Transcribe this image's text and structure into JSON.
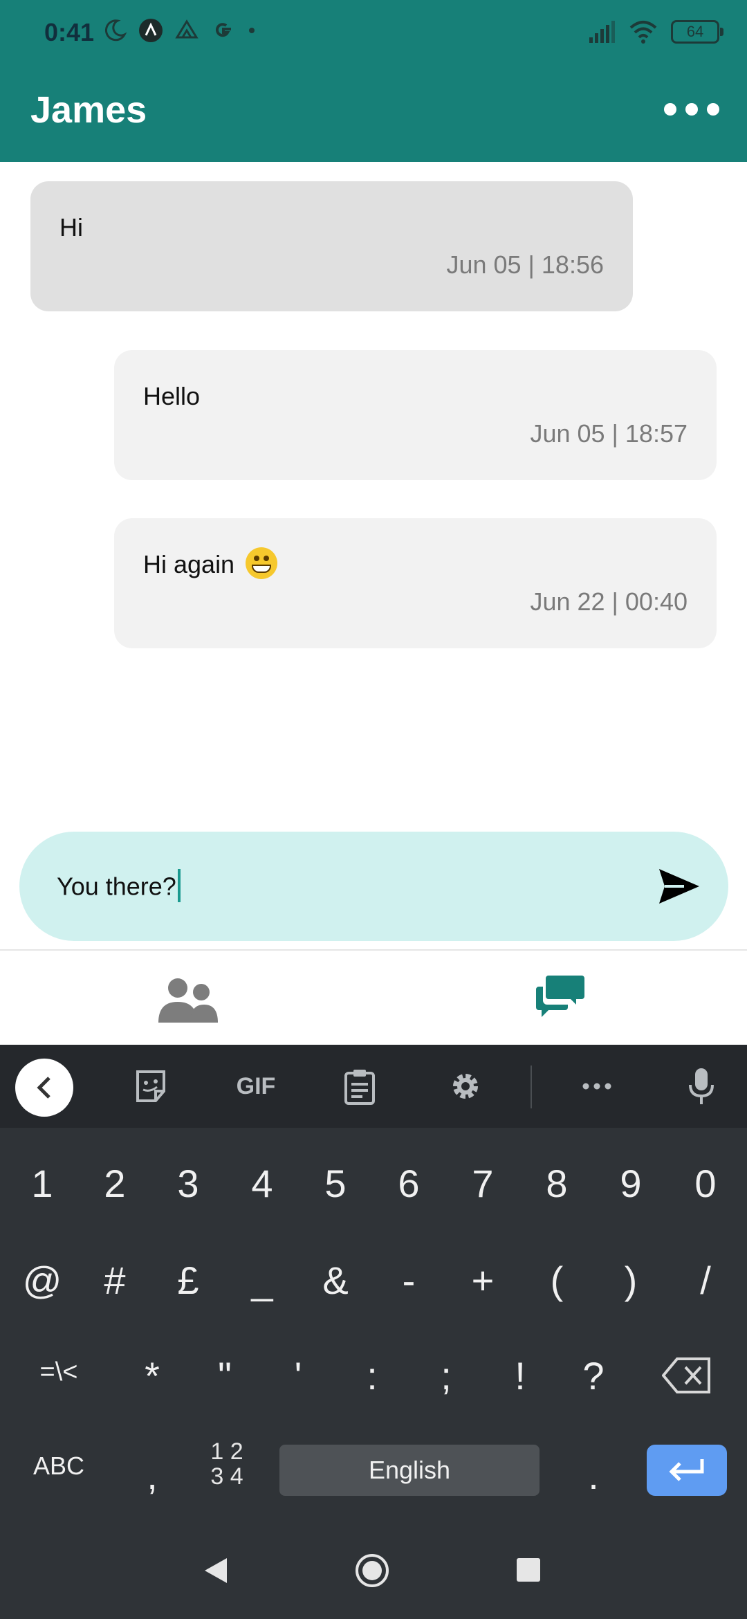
{
  "status_bar": {
    "time": "0:41",
    "battery": "64"
  },
  "header": {
    "title": "James"
  },
  "messages": [
    {
      "text": "Hi",
      "time": "Jun 05 | 18:56",
      "direction": "incoming"
    },
    {
      "text": "Hello",
      "time": "Jun 05 | 18:57",
      "direction": "outgoing"
    },
    {
      "text": "Hi again",
      "time": "Jun 22 | 00:40",
      "direction": "outgoing",
      "emoji": "grinning-face"
    }
  ],
  "composer": {
    "value": "You there?"
  },
  "keyboard": {
    "toolbar": {
      "gif_label": "GIF"
    },
    "row1": [
      "1",
      "2",
      "3",
      "4",
      "5",
      "6",
      "7",
      "8",
      "9",
      "0"
    ],
    "row2": [
      "@",
      "#",
      "£",
      "_",
      "&",
      "-",
      "+",
      "(",
      ")",
      "/"
    ],
    "row3": [
      "=\\<",
      "*",
      "\"",
      "'",
      ":",
      ";",
      "!",
      "?"
    ],
    "abc_label": "ABC",
    "comma": ",",
    "numpad_label_top": "1 2",
    "numpad_label_bottom": "3 4",
    "space_label": "English",
    "period": "."
  },
  "colors": {
    "header": "#178078",
    "accent": "#1a9a8f",
    "input_bg": "#d0f1ef",
    "enter_key": "#5f9cf2"
  }
}
